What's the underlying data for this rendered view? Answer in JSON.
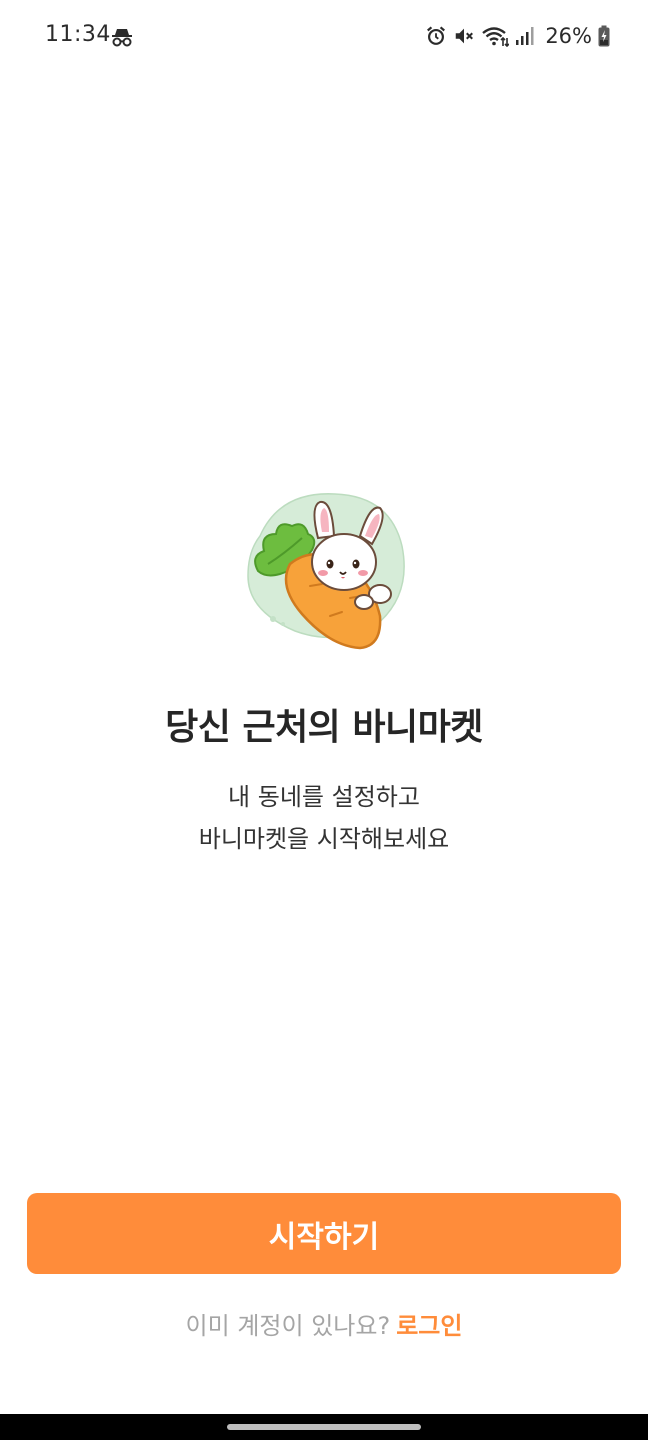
{
  "status_bar": {
    "time": "11:34",
    "battery_percent": "26%",
    "icons": [
      "incognito-icon",
      "alarm-icon",
      "mute-icon",
      "wifi-icon",
      "signal-icon",
      "battery-charging-icon"
    ]
  },
  "illustration": {
    "icon": "bunny-carrot-illustration"
  },
  "main": {
    "headline": "당신 근처의 바니마켓",
    "subtext_line1": "내 동네를 설정하고",
    "subtext_line2": "바니마켓을 시작해보세요"
  },
  "actions": {
    "start_label": "시작하기",
    "login_prompt": "이미 계정이 있나요?",
    "login_label": "로그인"
  },
  "colors": {
    "accent": "#ff8c3a",
    "text_primary": "#262626",
    "text_muted": "#a5a5a5"
  }
}
